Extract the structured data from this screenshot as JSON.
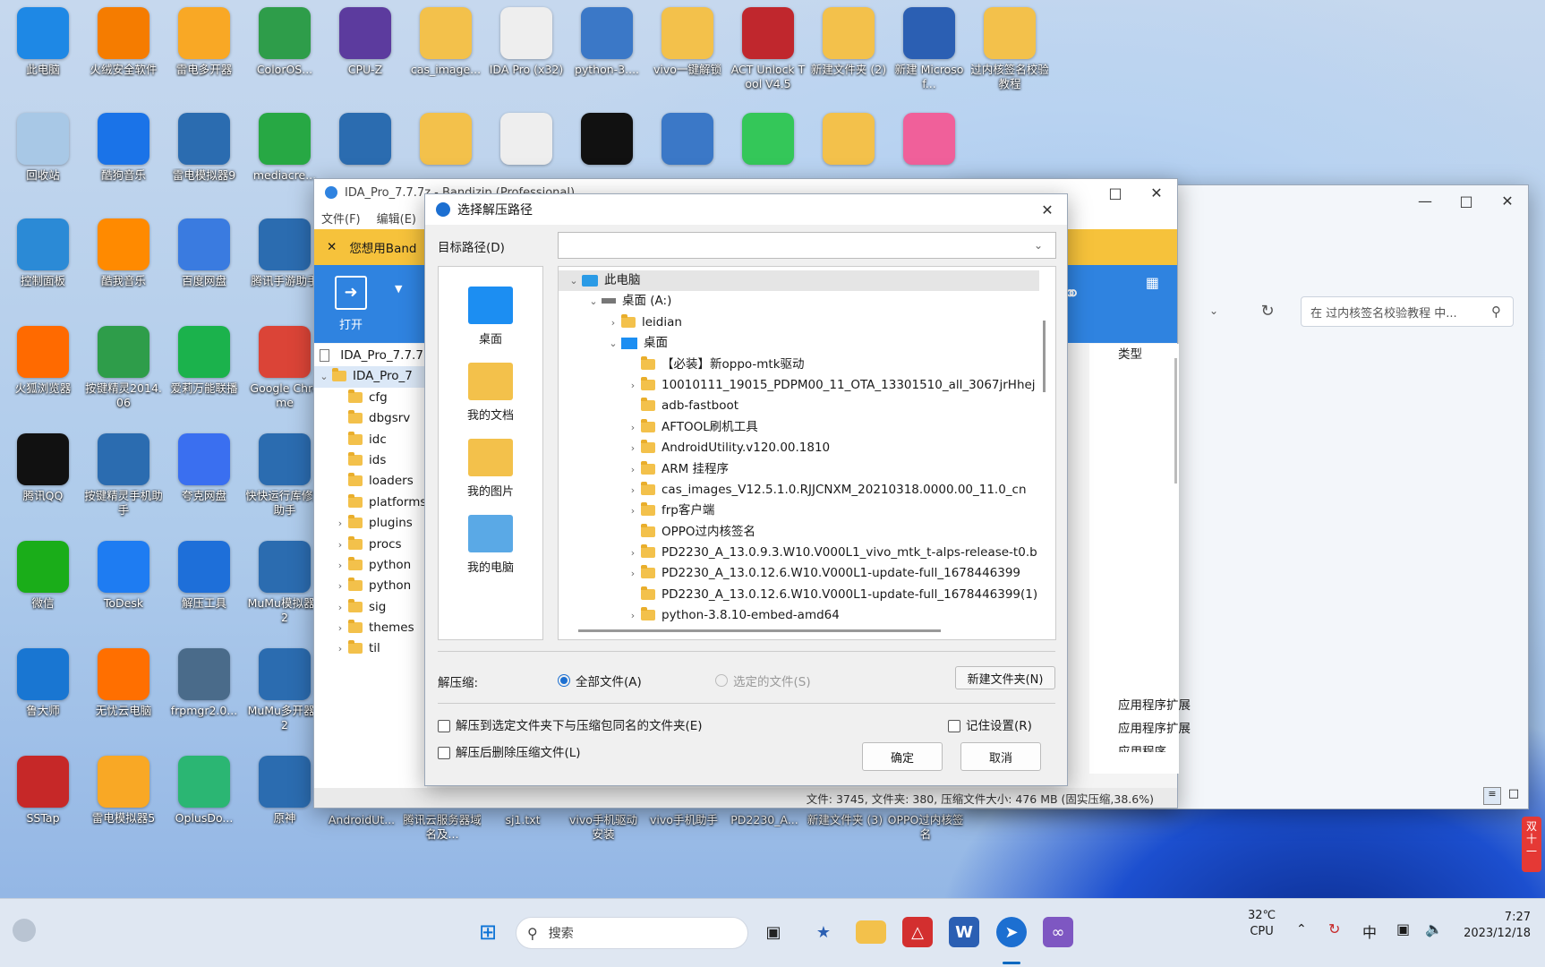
{
  "desktop": {
    "icons": [
      {
        "label": "此电脑",
        "icon": "computer-icon",
        "color": "#1e88e5"
      },
      {
        "label": "火绒安全软件",
        "icon": "huorong-icon",
        "color": "#f57c00"
      },
      {
        "label": "雷电多开器",
        "icon": "leidian-multi-icon",
        "color": "#f9a825"
      },
      {
        "label": "ColorOS...",
        "icon": "coloros-icon",
        "color": "#2e9d4a"
      },
      {
        "label": "CPU-Z",
        "icon": "cpuz-icon",
        "color": "#5c3b9e"
      },
      {
        "label": "cas_image...",
        "icon": "folder-icon",
        "color": "#f3c14b"
      },
      {
        "label": "IDA Pro (x32)",
        "icon": "file-icon",
        "color": "#eeeeee"
      },
      {
        "label": "python-3....",
        "icon": "installer-icon",
        "color": "#3b78c7"
      },
      {
        "label": "vivo一键解锁",
        "icon": "folder-icon",
        "color": "#f3c14b"
      },
      {
        "label": "ACT Unlock Tool V4.5",
        "icon": "act-unlock-icon",
        "color": "#c0272d"
      },
      {
        "label": "新建文件夹 (2)",
        "icon": "folder-icon",
        "color": "#f3c14b"
      },
      {
        "label": "新建 Microsof...",
        "icon": "word-icon",
        "color": "#2b5fb3"
      },
      {
        "label": "过内核签名校验教程",
        "icon": "folder-icon",
        "color": "#f3c14b"
      },
      {
        "label": "回收站",
        "icon": "recycle-bin-icon",
        "color": "#a8c8e6"
      },
      {
        "label": "酷狗音乐",
        "icon": "kugou-icon",
        "color": "#1a73e8"
      },
      {
        "label": "雷电模拟器9",
        "icon": "emulator-icon",
        "color": "#2b6cb0"
      },
      {
        "label": "mediacre...",
        "icon": "media-creation-icon",
        "color": "#27a844"
      },
      {
        "label": "",
        "icon": "tool-icon",
        "color": "#2b6cb0"
      },
      {
        "label": "",
        "icon": "folder-icon",
        "color": "#f3c14b"
      },
      {
        "label": "",
        "icon": "file-icon",
        "color": "#eeeeee"
      },
      {
        "label": "",
        "icon": "pycharm-icon",
        "color": "#111111"
      },
      {
        "label": "",
        "icon": "installer-icon",
        "color": "#3b78c7"
      },
      {
        "label": "",
        "icon": "green-app-icon",
        "color": "#34c759"
      },
      {
        "label": "",
        "icon": "folder-icon",
        "color": "#f3c14b"
      },
      {
        "label": "",
        "icon": "bilibili-icon",
        "color": "#f0609a"
      },
      {
        "label": "控制面板",
        "icon": "control-panel-icon",
        "color": "#2b8ad6"
      },
      {
        "label": "酷我音乐",
        "icon": "kuwo-icon",
        "color": "#ff8a00"
      },
      {
        "label": "百度网盘",
        "icon": "baidu-netdisk-icon",
        "color": "#3a7be0"
      },
      {
        "label": "腾讯手游助手",
        "icon": "tencent-game-icon",
        "color": "#2b6cb0"
      },
      {
        "label": "火狐浏览器",
        "icon": "firefox-icon",
        "color": "#ff6a00"
      },
      {
        "label": "按键精灵2014.06",
        "icon": "anjian-icon",
        "color": "#2e9d4a"
      },
      {
        "label": "爱莉万能联播",
        "icon": "ailian-icon",
        "color": "#1bb24c"
      },
      {
        "label": "Google Chrome",
        "icon": "chrome-icon",
        "color": "#db4437"
      },
      {
        "label": "腾讯QQ",
        "icon": "qq-icon",
        "color": "#111111"
      },
      {
        "label": "按键精灵手机助手",
        "icon": "anjian-mobile-icon",
        "color": "#2b6cb0"
      },
      {
        "label": "夸克网盘",
        "icon": "quark-icon",
        "color": "#3a6ff0"
      },
      {
        "label": "快快运行库修复助手",
        "icon": "repair-icon",
        "color": "#2b6cb0"
      },
      {
        "label": "微信",
        "icon": "wechat-icon",
        "color": "#1aad19"
      },
      {
        "label": "ToDesk",
        "icon": "todesk-icon",
        "color": "#1e7cf2"
      },
      {
        "label": "解压工具",
        "icon": "unzip-tool-icon",
        "color": "#1e6fd9"
      },
      {
        "label": "MuMu模拟器12",
        "icon": "mumu-icon",
        "color": "#2b6cb0"
      },
      {
        "label": "鲁大师",
        "icon": "ludashi-icon",
        "color": "#1976d2"
      },
      {
        "label": "无忧云电脑",
        "icon": "cloud-pc-icon",
        "color": "#ff6f00"
      },
      {
        "label": "frpmgr2.0...",
        "icon": "frpmgr-icon",
        "color": "#4a6b8a"
      },
      {
        "label": "MuMu多开器12",
        "icon": "mumu-multi-icon",
        "color": "#2b6cb0"
      },
      {
        "label": "SSTap",
        "icon": "sstap-icon",
        "color": "#c62828"
      },
      {
        "label": "雷电模拟器5",
        "icon": "leidian5-icon",
        "color": "#f9a825"
      },
      {
        "label": "OplusDo...",
        "icon": "oplus-icon",
        "color": "#2bb673"
      },
      {
        "label": "原神",
        "icon": "genshin-icon",
        "color": "#2b6cb0"
      }
    ],
    "bottom_labels": [
      "AndroidUt...",
      "腾讯云服务器域名及...",
      "sj1.txt",
      "vivo手机驱动安装",
      "vivo手机助手",
      "PD2230_A...",
      "新建文件夹 (3)",
      "OPPO过内核签名"
    ]
  },
  "bandizip": {
    "title": "IDA_Pro_7.7.7z - Bandizip (Professional)",
    "menu": [
      "文件(F)",
      "编辑(E)"
    ],
    "banner": "您想用Band",
    "open_label": "打开",
    "archive_name": "IDA_Pro_7.7.7",
    "tree_root": "IDA_Pro_7",
    "tree": [
      {
        "name": "cfg",
        "exp": false
      },
      {
        "name": "dbgsrv",
        "exp": false
      },
      {
        "name": "idc",
        "exp": false
      },
      {
        "name": "ids",
        "exp": false
      },
      {
        "name": "loaders",
        "exp": false
      },
      {
        "name": "platforms",
        "exp": false
      },
      {
        "name": "plugins",
        "exp": true
      },
      {
        "name": "procs",
        "exp": true
      },
      {
        "name": "python",
        "exp": true
      },
      {
        "name": "python",
        "exp": true
      },
      {
        "name": "sig",
        "exp": true
      },
      {
        "name": "themes",
        "exp": true
      },
      {
        "name": "til",
        "exp": true
      }
    ],
    "col_type": "类型",
    "right_items": [
      "应用程序扩展",
      "应用程序扩展",
      "应用程序"
    ],
    "status": "文件: 3745, 文件夹: 380, 压缩文件大小: 476 MB (固实压缩,38.6%)"
  },
  "explorer": {
    "search_placeholder": "在 过内核签名校验教程 中..."
  },
  "dialog": {
    "title": "选择解压路径",
    "target_label": "目标路径(D)",
    "target_value": "",
    "sidebar": [
      {
        "label": "桌面",
        "icon": "desktop-icon"
      },
      {
        "label": "我的文档",
        "icon": "documents-icon"
      },
      {
        "label": "我的图片",
        "icon": "pictures-icon"
      },
      {
        "label": "我的电脑",
        "icon": "my-computer-icon"
      }
    ],
    "tree": [
      {
        "label": "此电脑",
        "depth": 0,
        "arrow": "v",
        "icon": "pc",
        "sel": true
      },
      {
        "label": "桌面 (A:)",
        "depth": 1,
        "arrow": "v",
        "icon": "drive"
      },
      {
        "label": "leidian",
        "depth": 2,
        "arrow": ">",
        "icon": "folder"
      },
      {
        "label": "桌面",
        "depth": 2,
        "arrow": "v",
        "icon": "desk"
      },
      {
        "label": "【必装】新oppo-mtk驱动",
        "depth": 3,
        "arrow": "",
        "icon": "folder"
      },
      {
        "label": "10010111_19015_PDPM00_11_OTA_13301510_all_3067jrHhej",
        "depth": 3,
        "arrow": ">",
        "icon": "folder"
      },
      {
        "label": "adb-fastboot",
        "depth": 3,
        "arrow": "",
        "icon": "folder"
      },
      {
        "label": "AFTOOL刷机工具",
        "depth": 3,
        "arrow": ">",
        "icon": "folder"
      },
      {
        "label": "AndroidUtility.v120.00.1810",
        "depth": 3,
        "arrow": ">",
        "icon": "folder"
      },
      {
        "label": "ARM 挂程序",
        "depth": 3,
        "arrow": ">",
        "icon": "folder"
      },
      {
        "label": "cas_images_V12.5.1.0.RJJCNXM_20210318.0000.00_11.0_cn",
        "depth": 3,
        "arrow": ">",
        "icon": "folder"
      },
      {
        "label": "frp客户端",
        "depth": 3,
        "arrow": ">",
        "icon": "folder"
      },
      {
        "label": "OPPO过内核签名",
        "depth": 3,
        "arrow": "",
        "icon": "folder"
      },
      {
        "label": "PD2230_A_13.0.9.3.W10.V000L1_vivo_mtk_t-alps-release-t0.b",
        "depth": 3,
        "arrow": ">",
        "icon": "folder"
      },
      {
        "label": "PD2230_A_13.0.12.6.W10.V000L1-update-full_1678446399",
        "depth": 3,
        "arrow": ">",
        "icon": "folder"
      },
      {
        "label": "PD2230_A_13.0.12.6.W10.V000L1-update-full_1678446399(1)",
        "depth": 3,
        "arrow": "",
        "icon": "folder"
      },
      {
        "label": "python-3.8.10-embed-amd64",
        "depth": 3,
        "arrow": ">",
        "icon": "folder"
      }
    ],
    "extract_label": "解压缩:",
    "radio_all": "全部文件(A)",
    "radio_selected": "选定的文件(S)",
    "new_folder": "新建文件夹(N)",
    "cb_same_name": "解压到选定文件夹下与压缩包同名的文件夹(E)",
    "cb_remember": "记住设置(R)",
    "cb_delete": "解压后删除压缩文件(L)",
    "ok": "确定",
    "cancel": "取消"
  },
  "taskbar": {
    "search": "搜索",
    "temp": "32℃",
    "temp_sub": "CPU",
    "ime": "中",
    "time": "7:27",
    "date": "2023/12/18"
  },
  "colors": {
    "accent": "#0067c0",
    "bandizip_blue": "#2f83e0",
    "banner": "#f6c23b"
  }
}
